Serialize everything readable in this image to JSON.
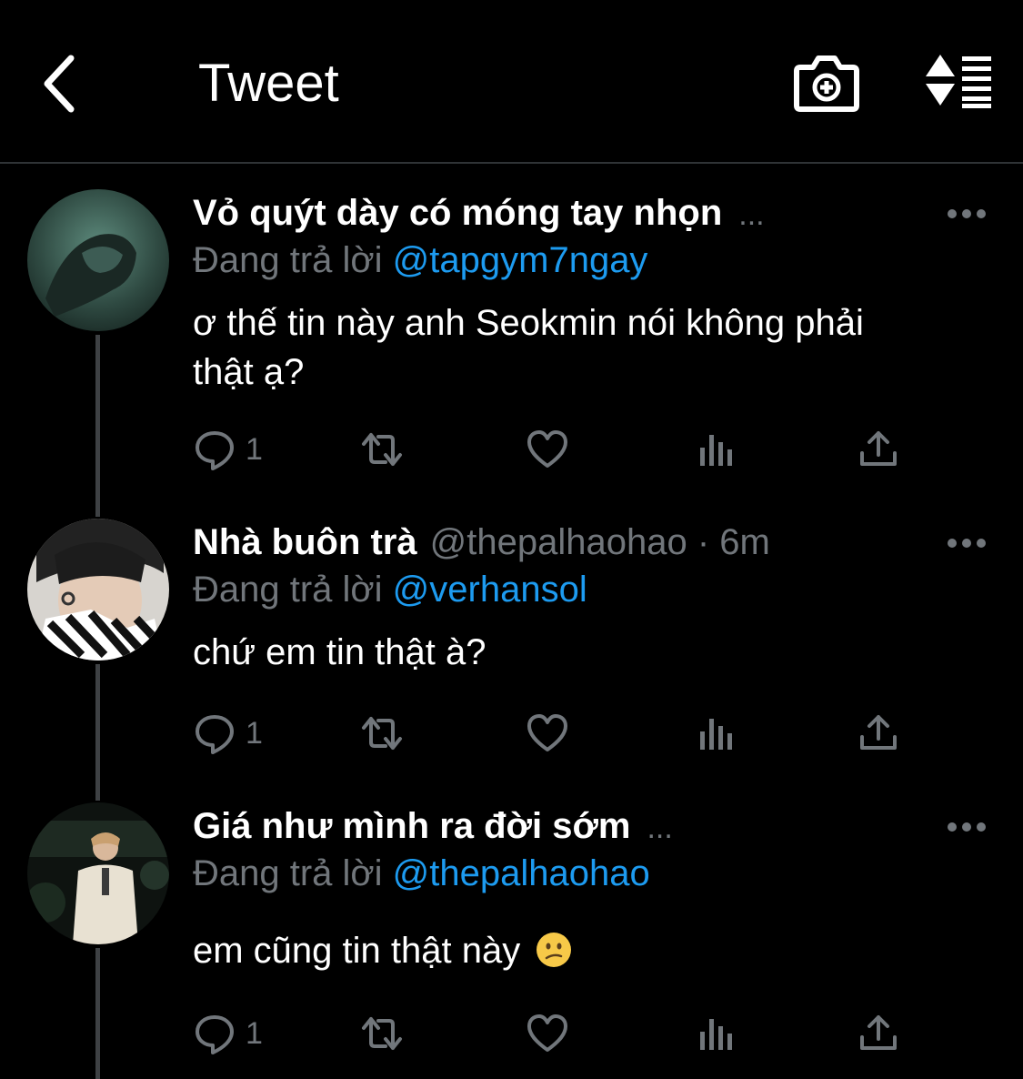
{
  "header": {
    "title": "Tweet"
  },
  "tweets": [
    {
      "name": "Vỏ quýt dày có móng tay nhọn",
      "handle_time": "",
      "truncation": "...",
      "reply_prefix": "Đang trả lời",
      "reply_to": "@tapgym7ngay",
      "text_line1": "ơ thế tin này anh Seokmin nói không phải",
      "text_line2": "thật ạ?",
      "reply_count": "1"
    },
    {
      "name": "Nhà buôn trà",
      "handle_time": "@thepalhaohao · 6m",
      "truncation": "",
      "reply_prefix": "Đang trả lời",
      "reply_to": "@verhansol",
      "text_line1": "chứ em tin thật à?",
      "text_line2": "",
      "reply_count": "1"
    },
    {
      "name": "Giá như mình ra đời sớm",
      "handle_time": "",
      "truncation": "...",
      "reply_prefix": "Đang trả lời",
      "reply_to": "@thepalhaohao",
      "text_line1": "em cũng tin thật này",
      "text_line2": "",
      "reply_count": "1"
    }
  ],
  "colors": {
    "background": "#000000",
    "link": "#1d9bf0",
    "secondary_text": "#71767b",
    "thread_line": "#3e4144"
  },
  "icons": [
    "back-icon",
    "camera-plus-icon",
    "sort-icon",
    "more-icon",
    "reply-icon",
    "retweet-icon",
    "like-icon",
    "views-icon",
    "share-icon",
    "confused-face-emoji"
  ]
}
